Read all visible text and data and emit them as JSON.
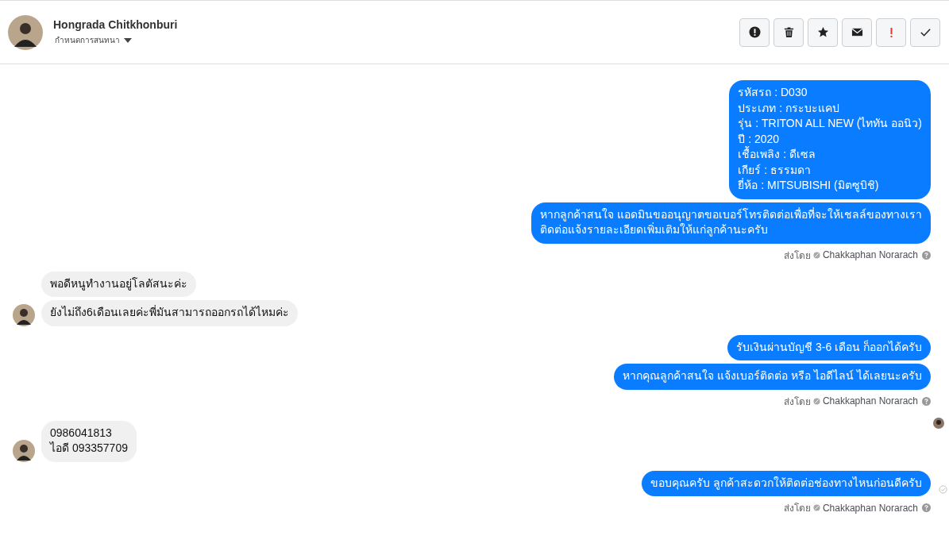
{
  "header": {
    "name": "Hongrada Chitkhonburi",
    "subtitle": "กำหนดการสนทนา",
    "actions": [
      {
        "kind": "alert"
      },
      {
        "kind": "trash"
      },
      {
        "kind": "star"
      },
      {
        "kind": "mail"
      },
      {
        "kind": "important"
      },
      {
        "kind": "done"
      }
    ]
  },
  "messages": [
    {
      "kind": "outgoing",
      "bubbles": [
        {
          "paragraphs": [
            [
              "รหัสรถ : D030",
              "ประเภท : กระบะแคป",
              "รุ่น : TRITON ALL NEW (ไททัน ออนิว)",
              "ปี : 2020",
              "เชื้อเพลิง : ดีเซล",
              "เกียร์ : ธรรมดา",
              "ยี่ห้อ : MITSUBISHI (มิตซูบิชิ)"
            ]
          ]
        },
        {
          "paragraphs": [
            [
              "หากลูกค้าสนใจ แอดมินขออนุญาตขอเบอร์โทรติดต่อเพื่อที่จะให้เชลล์ของทางเรา",
              "ติดต่อแจ้งรายละเอียดเพิ่มเติมให้แก่ลูกค้านะครับ"
            ]
          ]
        }
      ],
      "sent_by": {
        "label": "ส่งโดย",
        "name": "Chakkaphan Norarach"
      }
    },
    {
      "kind": "incoming",
      "bubbles": [
        {
          "paragraphs": [
            [
              "พอดีหนูทำงานอยู่โลตัสนะค่ะ"
            ]
          ]
        },
        {
          "paragraphs": [
            [
              "ยังไม่ถึง6เดือนเลยค่ะพี่มันสามารถออกรถได้ไหมค่ะ"
            ]
          ]
        }
      ]
    },
    {
      "kind": "outgoing",
      "bubbles": [
        {
          "paragraphs": [
            [
              "รับเงินผ่านบัญชี 3-6 เดือน ก็ออกได้ครับ"
            ]
          ]
        },
        {
          "paragraphs": [
            [
              "หากคุณลูกค้าสนใจ แจ้งเบอร์ติดต่อ หรือ ไอดีไลน์ ได้เลยนะครับ"
            ]
          ]
        }
      ],
      "sent_by": {
        "label": "ส่งโดย",
        "name": "Chakkaphan Norarach"
      }
    },
    {
      "kind": "incoming",
      "bubbles": [
        {
          "paragraphs": [
            [
              "0986041813",
              "ไอดี 093357709"
            ]
          ]
        }
      ],
      "seen": true
    },
    {
      "kind": "outgoing",
      "bubbles": [
        {
          "paragraphs": [
            [
              "ขอบคุณครับ ลูกค้าสะดวกให้ติดต่อช่องทางไหนก่อนดีครับ"
            ]
          ]
        }
      ],
      "delivered": true,
      "sent_by": {
        "label": "ส่งโดย",
        "name": "Chakkaphan Norarach"
      }
    }
  ]
}
